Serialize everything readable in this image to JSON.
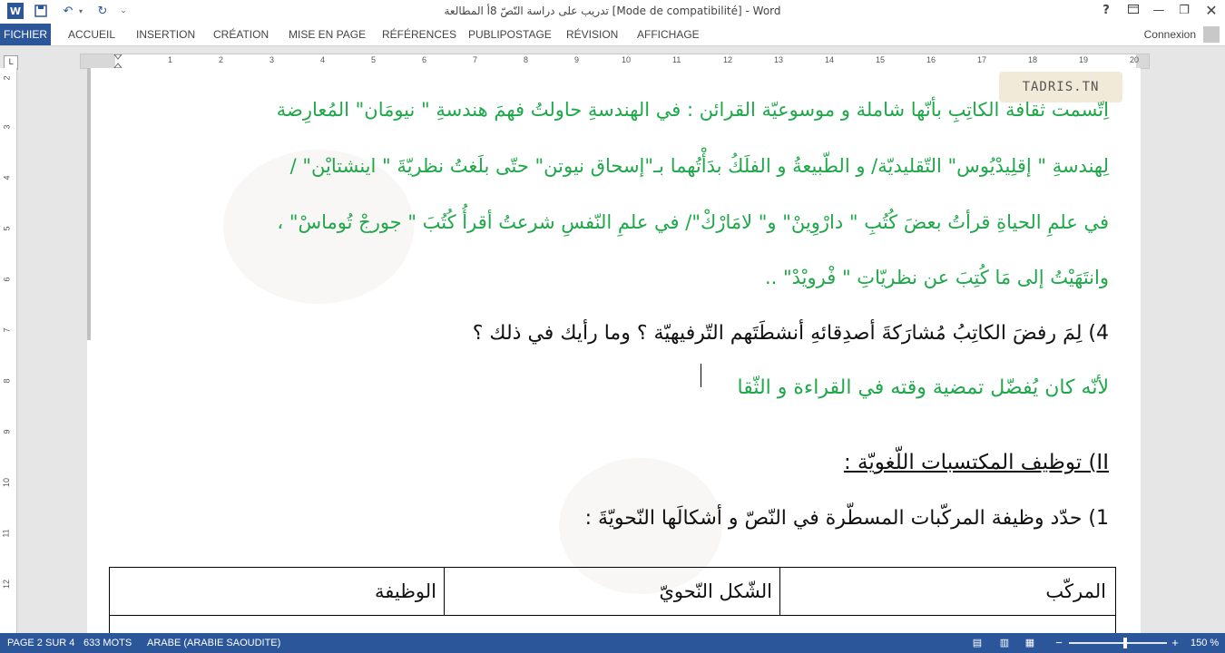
{
  "window": {
    "title": "تدريب على دراسة النّصّ 8أ المطالعة [Mode de compatibilité] - Word",
    "help_label": "?",
    "qa_icons": [
      "word-logo-icon",
      "save-icon",
      "undo-icon",
      "redo-icon"
    ]
  },
  "ribbon": {
    "tabs": [
      "FICHIER",
      "ACCUEIL",
      "INSERTION",
      "CRÉATION",
      "MISE EN PAGE",
      "RÉFÉRENCES",
      "PUBLIPOSTAGE",
      "RÉVISION",
      "AFFICHAGE"
    ],
    "signin": "Connexion"
  },
  "ruler": {
    "h_numbers": [
      "1",
      "2",
      "3",
      "4",
      "5",
      "6",
      "7",
      "8",
      "9",
      "10",
      "11",
      "12",
      "13",
      "14",
      "15",
      "16",
      "17",
      "18",
      "19",
      "20"
    ],
    "v_numbers": [
      "2",
      "3",
      "4",
      "5",
      "6",
      "7",
      "8",
      "9",
      "10",
      "11",
      "12"
    ],
    "corner": "L"
  },
  "document": {
    "logo_text": "TADRIS.TN",
    "lines": [
      {
        "text": "اِتّسمت ثقافة الكاتِبِ بأنّها شاملة و موسوعيّة القرائن : في الهندسةِ حاولتُ فهمَ هندسةِ \" نيومَان\" المُعارِضة",
        "color": "green"
      },
      {
        "text": "لِهندسةِ \" إقلِيدْيُوس\" التّقليديّة/  و الطّبيعةُ و الفلَكُ بدَأْتُهما بـ\"إسحاق نيوتن\" حتّى بلَغتُ نظريّةَ \" اينشتايْن\" /",
        "color": "green"
      },
      {
        "text": "في علمِ الحياةِ قرأتُ بعضَ كُتُبِ \" دارْوِينْ\" و\" لامَارْكْ\"/ في علمِ النّفسِ شرعتُ أقرأُ كُتُبَ \" جورجْ تُوماسْ\" ،",
        "color": "green"
      },
      {
        "text": "وانتَهَيْتُ إلى مَا كُتِبَ عن نظريّاتِ \" فْرويْدْ\" ..",
        "color": "green"
      },
      {
        "text": "4) لِمَ رفضَ الكاتِبُ مُشارَكةَ أصدِقائهِ أنشطَتَهم التّرفيهيّة ؟ وما رأيك في ذلك ؟",
        "color": "black"
      },
      {
        "text": "لأنّه كان يُفضّل تمضية وقته في القراءة و الثّقا",
        "color": "green"
      },
      {
        "text": "II) توظيف المكتسبات اللّغويّة :",
        "color": "black"
      },
      {
        "text": "1) حدّد وظيفة المركّبات المسطّرة في النّصّ و أشكالَها النّحويّةَ :",
        "color": "black"
      }
    ],
    "table_headers": [
      "المركّب",
      "الشّكل النّحويّ",
      "الوظيفة"
    ]
  },
  "statusbar": {
    "page": "PAGE 2 SUR 4",
    "words": "633 MOTS",
    "language": "ARABE (ARABIE SAOUDITE)",
    "zoom": "150 %",
    "zoom_fraction": 0.5
  }
}
